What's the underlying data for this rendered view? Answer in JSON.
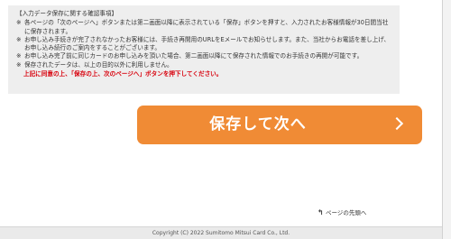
{
  "notice": {
    "title": "【入力データ保存に関する確認事項】",
    "items": [
      {
        "mark": "※",
        "text": "各ページの「次のページへ」ボタンまたは第二画面以降に表示されている「保存」ボタンを押すと、入力されたお客様情報が30日間当社に保存されます。"
      },
      {
        "mark": "※",
        "text": "お申し込み手続きが完了されなかったお客様には、手続き再開用のURLをEメールでお知らせします。また、当社からお電話を差し上げ、お申し込み続行のご案内をすることがございます。"
      },
      {
        "mark": "※",
        "text": "お申し込み完了前に同じカードのお申し込みを頂いた場合、第二画面以降にて保存された情報でのお手続きの再開が可能です。"
      },
      {
        "mark": "※",
        "text": "保存されたデータは、以上の目的以外に利用しません。"
      }
    ],
    "agreement": "上記に同意の上、「保存の上、次のページへ」ボタンを押下してください。"
  },
  "save_button": {
    "label": "保存して次へ",
    "icon": "chevron-right-icon"
  },
  "page_top": {
    "icon": "arrow-up-icon",
    "icon_glyph": "↰",
    "label": "ページの先頭へ"
  },
  "footer": {
    "copyright": "Copyright (C) 2022 Sumitomo Mitsui Card Co., Ltd."
  },
  "colors": {
    "accent": "#f08b35",
    "warning_text": "#d8000c",
    "notice_background": "#eeeeee"
  }
}
